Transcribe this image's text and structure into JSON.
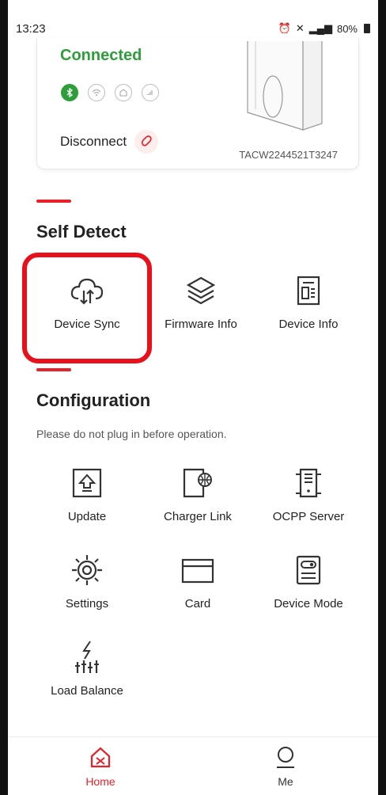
{
  "status_bar": {
    "time": "13:23",
    "indicators": "⏰ ⚡ 4G .∥l",
    "battery": "80%"
  },
  "device": {
    "status": "Connected",
    "connection_icons": [
      "bluetooth-icon",
      "wifi-icon",
      "ethernet-icon",
      "cellular-icon"
    ],
    "disconnect_label": "Disconnect",
    "serial": "TACW2244521T3247",
    "status_color": "#2e9e3a"
  },
  "self_detect": {
    "title": "Self Detect",
    "items": [
      {
        "label": "Device Sync",
        "icon": "cloud-sync-icon"
      },
      {
        "label": "Firmware Info",
        "icon": "layers-icon"
      },
      {
        "label": "Device Info",
        "icon": "document-icon"
      }
    ]
  },
  "configuration": {
    "title": "Configuration",
    "note": "Please do not plug in before operation.",
    "items": [
      {
        "label": "Update",
        "icon": "upload-icon"
      },
      {
        "label": "Charger Link",
        "icon": "charger-link-icon"
      },
      {
        "label": "OCPP Server",
        "icon": "server-icon"
      },
      {
        "label": "Settings",
        "icon": "gear-icon"
      },
      {
        "label": "Card",
        "icon": "card-icon"
      },
      {
        "label": "Device Mode",
        "icon": "device-mode-icon"
      },
      {
        "label": "Load Balance",
        "icon": "load-balance-icon"
      }
    ]
  },
  "bottom_nav": {
    "items": [
      {
        "label": "Home",
        "icon": "home-icon",
        "active": true
      },
      {
        "label": "Me",
        "icon": "profile-icon",
        "active": false
      }
    ]
  },
  "colors": {
    "accent": "#e8202a",
    "highlight": "#e8101a"
  }
}
